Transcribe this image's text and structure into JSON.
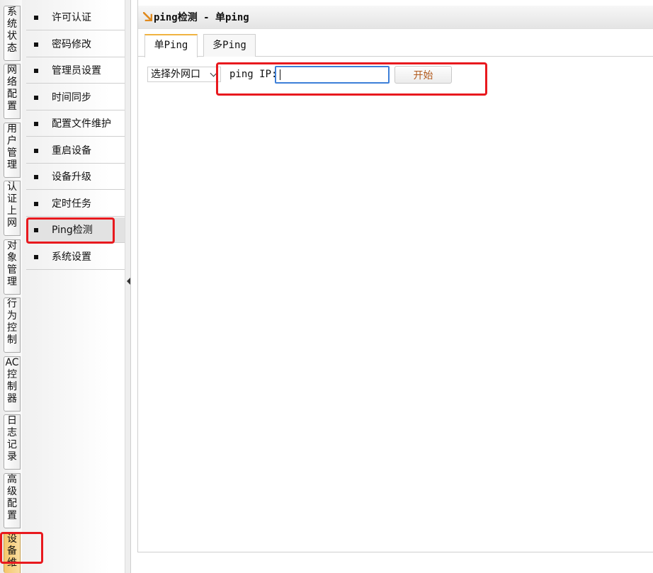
{
  "categories": [
    {
      "label": "系统状态",
      "chars": [
        "系",
        "统",
        "状",
        "态"
      ]
    },
    {
      "label": "网络配置",
      "chars": [
        "网",
        "络",
        "配",
        "置"
      ]
    },
    {
      "label": "用户管理",
      "chars": [
        "用",
        "户",
        "管",
        "理"
      ]
    },
    {
      "label": "认证上网",
      "chars": [
        "认",
        "证",
        "上",
        "网"
      ]
    },
    {
      "label": "对象管理",
      "chars": [
        "对",
        "象",
        "管",
        "理"
      ]
    },
    {
      "label": "行为控制",
      "chars": [
        "行",
        "为",
        "控",
        "制"
      ]
    },
    {
      "label": "AC控制器",
      "chars": [
        "AC",
        "控",
        "制",
        "器"
      ]
    },
    {
      "label": "日志记录",
      "chars": [
        "日",
        "志",
        "记",
        "录"
      ]
    },
    {
      "label": "高级配置",
      "chars": [
        "高",
        "级",
        "配",
        "置"
      ]
    },
    {
      "label": "设备维",
      "chars": [
        "设",
        "备",
        "维"
      ]
    }
  ],
  "submenu": {
    "items": [
      {
        "label": "许可认证"
      },
      {
        "label": "密码修改"
      },
      {
        "label": "管理员设置"
      },
      {
        "label": "时间同步"
      },
      {
        "label": "配置文件维护"
      },
      {
        "label": "重启设备"
      },
      {
        "label": "设备升级"
      },
      {
        "label": "定时任务"
      },
      {
        "label": "Ping检测"
      },
      {
        "label": "系统设置"
      }
    ]
  },
  "main": {
    "title": "ping检测 - 单ping",
    "tabs": [
      {
        "label": "单Ping"
      },
      {
        "label": "多Ping"
      }
    ],
    "form": {
      "interface_select": "选择外网口",
      "ping_ip_label": "ping IP:",
      "ip_value": "",
      "start_button": "开始"
    }
  },
  "colors": {
    "accent": "#f0b340",
    "highlight": "#e8191e",
    "input_focus": "#3d7fd8",
    "button_text": "#b25a1d"
  }
}
